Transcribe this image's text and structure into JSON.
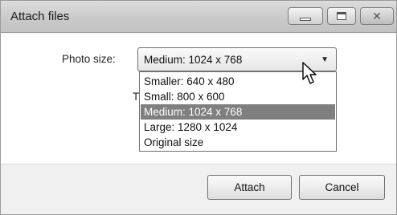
{
  "window": {
    "title": "Attach files",
    "controls": {
      "minimize": "minimize",
      "maximize": "maximize",
      "close": "✕"
    }
  },
  "form": {
    "photo_size_label": "Photo size:",
    "partial_label": "T",
    "select": {
      "value": "Medium: 1024 x 768",
      "arrow": "▼"
    },
    "options": [
      {
        "label": "Smaller: 640 x 480",
        "selected": false
      },
      {
        "label": "Small: 800 x 600",
        "selected": false
      },
      {
        "label": "Medium: 1024 x 768",
        "selected": true
      },
      {
        "label": "Large: 1280 x 1024",
        "selected": false
      },
      {
        "label": "Original size",
        "selected": false
      }
    ]
  },
  "buttons": {
    "attach": "Attach",
    "cancel": "Cancel"
  },
  "colors": {
    "highlight": "#7f7f7f",
    "titlebar": "#c9c9c9",
    "content_bg": "#ffffff",
    "footer_bg": "#f0f0f0"
  }
}
